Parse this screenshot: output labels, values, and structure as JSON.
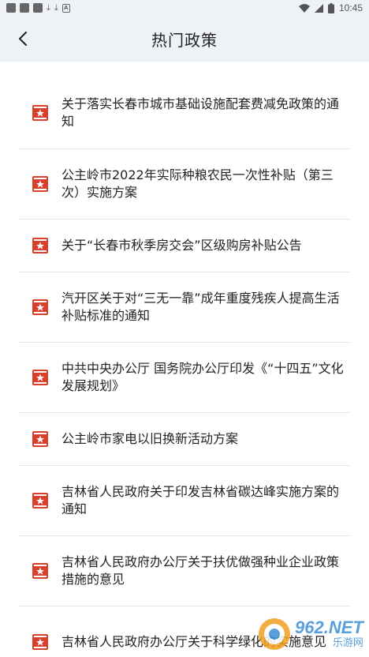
{
  "status_bar": {
    "time": "10:45"
  },
  "header": {
    "title": "热门政策"
  },
  "colors": {
    "accent_red": "#d9402b",
    "header_bg": "#eef2f6"
  },
  "policies": [
    {
      "title": "关于落实长春市城市基础设施配套费减免政策的通知"
    },
    {
      "title": "公主岭市2022年实际种粮农民一次性补贴（第三次）实施方案"
    },
    {
      "title": "关于“长春市秋季房交会”区级购房补贴公告"
    },
    {
      "title": "汽开区关于对“三无一靠”成年重度残疾人提高生活补贴标准的通知"
    },
    {
      "title": "中共中央办公厅 国务院办公厅印发《“十四五”文化发展规划》"
    },
    {
      "title": "公主岭市家电以旧换新活动方案"
    },
    {
      "title": "吉林省人民政府关于印发吉林省碳达峰实施方案的通知"
    },
    {
      "title": "吉林省人民政府办公厅关于扶优做强种业企业政策措施的意见"
    },
    {
      "title": "吉林省人民政府办公厅关于科学绿化的实施意见"
    }
  ],
  "watermark": {
    "brand": "962.NET",
    "sub": "乐游网"
  }
}
